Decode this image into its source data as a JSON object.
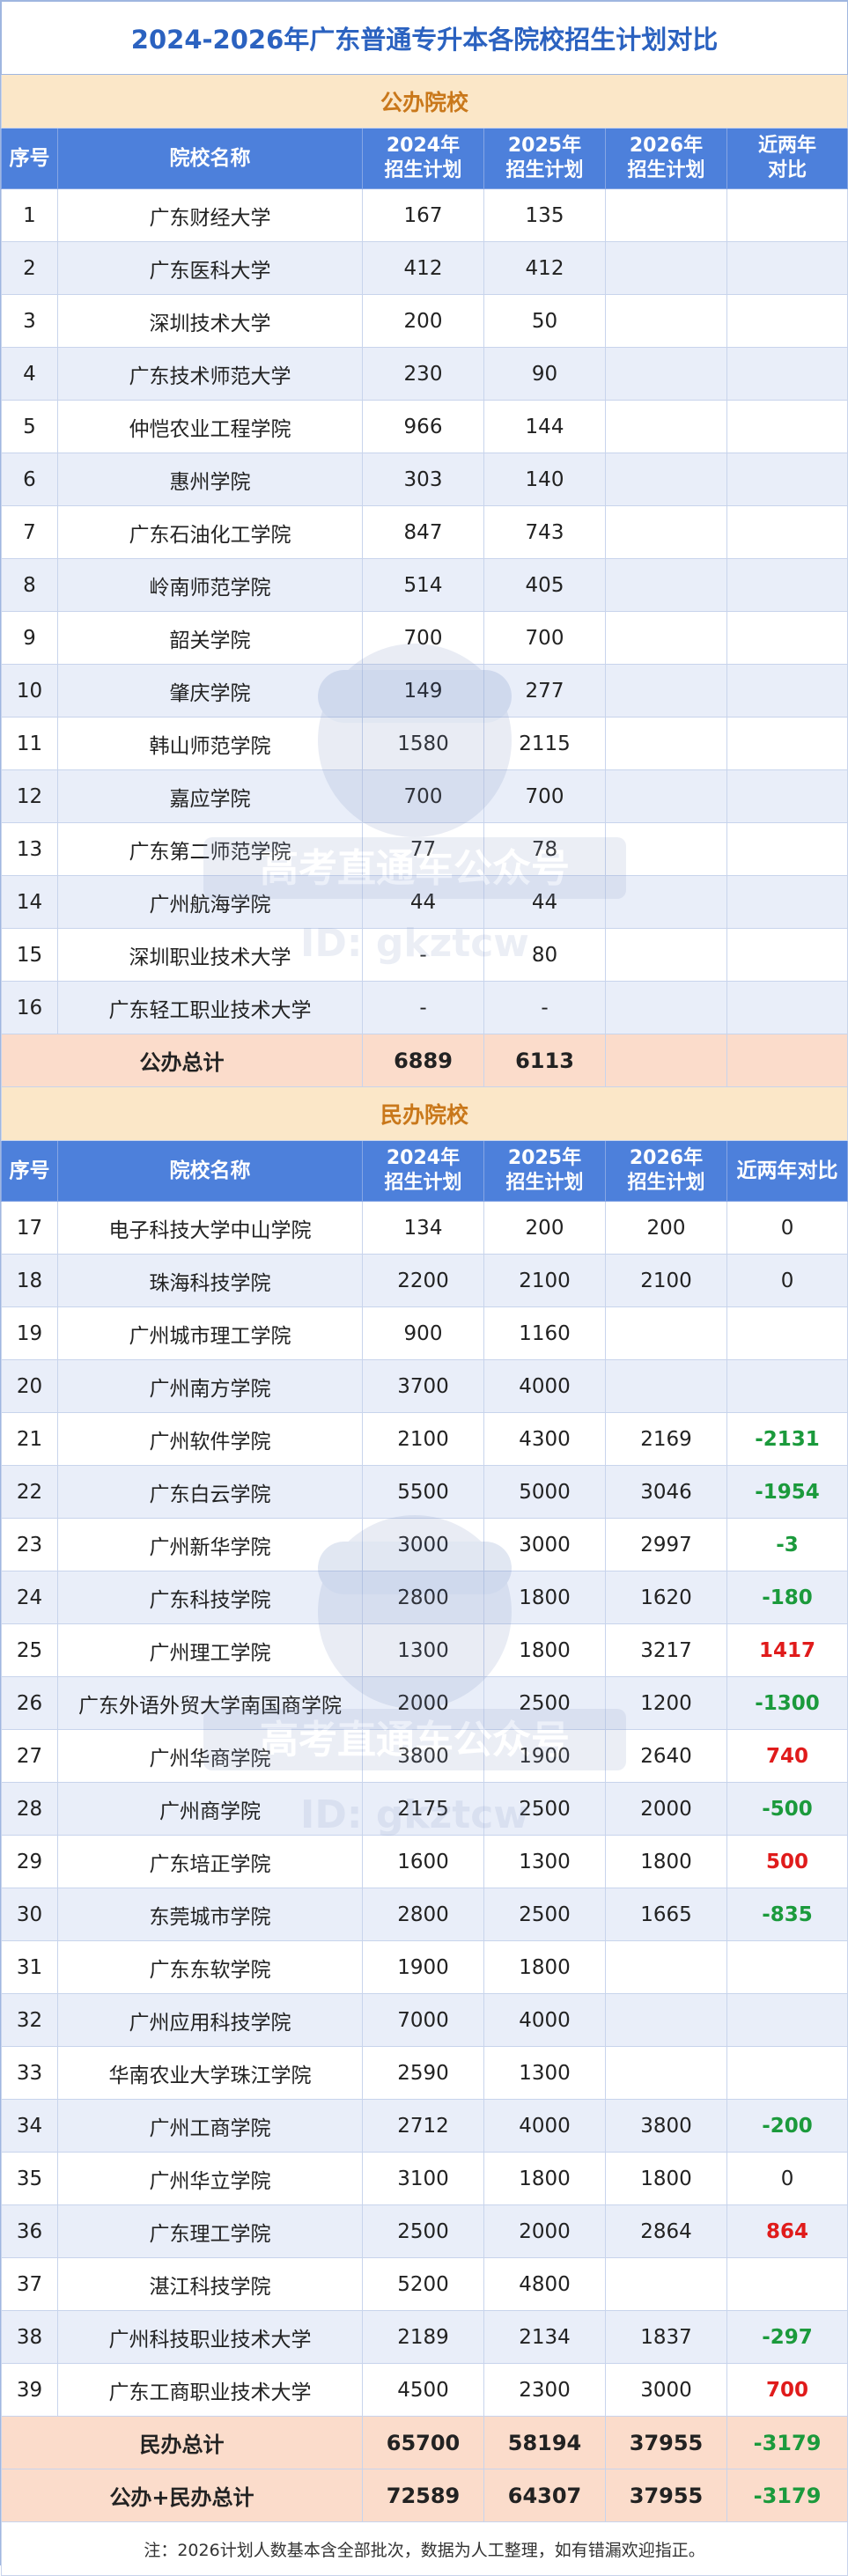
{
  "title": "2024-2026年广东普通专升本各院校招生计划对比",
  "watermark": {
    "line1": "高考直通车公众号",
    "line2": "ID: gkztcw"
  },
  "colors": {
    "header_bg": "#4d80db",
    "section_bg": "#fbe7c8",
    "total_bg": "#fbdccb",
    "stripe": "#e9eef9",
    "negative": "#1b9a3c",
    "positive": "#e01b1b",
    "title": "#2b62c0"
  },
  "public": {
    "section_label": "公办院校",
    "headers": {
      "idx": "序号",
      "name": "院校名称",
      "y2024_l1": "2024年",
      "y2024_l2": "招生计划",
      "y2025_l1": "2025年",
      "y2025_l2": "招生计划",
      "y2026_l1": "2026年",
      "y2026_l2": "招生计划",
      "cmp_l1": "近两年",
      "cmp_l2": "对比"
    },
    "rows": [
      {
        "idx": "1",
        "name": "广东财经大学",
        "y2024": "167",
        "y2025": "135",
        "y2026": "",
        "cmp": ""
      },
      {
        "idx": "2",
        "name": "广东医科大学",
        "y2024": "412",
        "y2025": "412",
        "y2026": "",
        "cmp": ""
      },
      {
        "idx": "3",
        "name": "深圳技术大学",
        "y2024": "200",
        "y2025": "50",
        "y2026": "",
        "cmp": ""
      },
      {
        "idx": "4",
        "name": "广东技术师范大学",
        "y2024": "230",
        "y2025": "90",
        "y2026": "",
        "cmp": ""
      },
      {
        "idx": "5",
        "name": "仲恺农业工程学院",
        "y2024": "966",
        "y2025": "144",
        "y2026": "",
        "cmp": ""
      },
      {
        "idx": "6",
        "name": "惠州学院",
        "y2024": "303",
        "y2025": "140",
        "y2026": "",
        "cmp": ""
      },
      {
        "idx": "7",
        "name": "广东石油化工学院",
        "y2024": "847",
        "y2025": "743",
        "y2026": "",
        "cmp": ""
      },
      {
        "idx": "8",
        "name": "岭南师范学院",
        "y2024": "514",
        "y2025": "405",
        "y2026": "",
        "cmp": ""
      },
      {
        "idx": "9",
        "name": "韶关学院",
        "y2024": "700",
        "y2025": "700",
        "y2026": "",
        "cmp": ""
      },
      {
        "idx": "10",
        "name": "肇庆学院",
        "y2024": "149",
        "y2025": "277",
        "y2026": "",
        "cmp": ""
      },
      {
        "idx": "11",
        "name": "韩山师范学院",
        "y2024": "1580",
        "y2025": "2115",
        "y2026": "",
        "cmp": ""
      },
      {
        "idx": "12",
        "name": "嘉应学院",
        "y2024": "700",
        "y2025": "700",
        "y2026": "",
        "cmp": ""
      },
      {
        "idx": "13",
        "name": "广东第二师范学院",
        "y2024": "77",
        "y2025": "78",
        "y2026": "",
        "cmp": ""
      },
      {
        "idx": "14",
        "name": "广州航海学院",
        "y2024": "44",
        "y2025": "44",
        "y2026": "",
        "cmp": ""
      },
      {
        "idx": "15",
        "name": "深圳职业技术大学",
        "y2024": "-",
        "y2025": "80",
        "y2026": "",
        "cmp": ""
      },
      {
        "idx": "16",
        "name": "广东轻工职业技术大学",
        "y2024": "-",
        "y2025": "-",
        "y2026": "",
        "cmp": ""
      }
    ],
    "total": {
      "label": "公办总计",
      "y2024": "6889",
      "y2025": "6113",
      "y2026": "",
      "cmp": ""
    }
  },
  "private": {
    "section_label": "民办院校",
    "headers": {
      "idx": "序号",
      "name": "院校名称",
      "y2024_l1": "2024年",
      "y2024_l2": "招生计划",
      "y2025_l1": "2025年",
      "y2025_l2": "招生计划",
      "y2026_l1": "2026年",
      "y2026_l2": "招生计划",
      "cmp": "近两年对比"
    },
    "rows": [
      {
        "idx": "17",
        "name": "电子科技大学中山学院",
        "y2024": "134",
        "y2025": "200",
        "y2026": "200",
        "cmp": "0",
        "tone": "plain"
      },
      {
        "idx": "18",
        "name": "珠海科技学院",
        "y2024": "2200",
        "y2025": "2100",
        "y2026": "2100",
        "cmp": "0",
        "tone": "plain"
      },
      {
        "idx": "19",
        "name": "广州城市理工学院",
        "y2024": "900",
        "y2025": "1160",
        "y2026": "",
        "cmp": "",
        "tone": "plain"
      },
      {
        "idx": "20",
        "name": "广州南方学院",
        "y2024": "3700",
        "y2025": "4000",
        "y2026": "",
        "cmp": "",
        "tone": "plain"
      },
      {
        "idx": "21",
        "name": "广州软件学院",
        "y2024": "2100",
        "y2025": "4300",
        "y2026": "2169",
        "cmp": "-2131",
        "tone": "green"
      },
      {
        "idx": "22",
        "name": "广东白云学院",
        "y2024": "5500",
        "y2025": "5000",
        "y2026": "3046",
        "cmp": "-1954",
        "tone": "green"
      },
      {
        "idx": "23",
        "name": "广州新华学院",
        "y2024": "3000",
        "y2025": "3000",
        "y2026": "2997",
        "cmp": "-3",
        "tone": "green"
      },
      {
        "idx": "24",
        "name": "广东科技学院",
        "y2024": "2800",
        "y2025": "1800",
        "y2026": "1620",
        "cmp": "-180",
        "tone": "green"
      },
      {
        "idx": "25",
        "name": "广州理工学院",
        "y2024": "1300",
        "y2025": "1800",
        "y2026": "3217",
        "cmp": "1417",
        "tone": "red"
      },
      {
        "idx": "26",
        "name": "广东外语外贸大学南国商学院",
        "y2024": "2000",
        "y2025": "2500",
        "y2026": "1200",
        "cmp": "-1300",
        "tone": "green"
      },
      {
        "idx": "27",
        "name": "广州华商学院",
        "y2024": "3800",
        "y2025": "1900",
        "y2026": "2640",
        "cmp": "740",
        "tone": "red"
      },
      {
        "idx": "28",
        "name": "广州商学院",
        "y2024": "2175",
        "y2025": "2500",
        "y2026": "2000",
        "cmp": "-500",
        "tone": "green"
      },
      {
        "idx": "29",
        "name": "广东培正学院",
        "y2024": "1600",
        "y2025": "1300",
        "y2026": "1800",
        "cmp": "500",
        "tone": "red"
      },
      {
        "idx": "30",
        "name": "东莞城市学院",
        "y2024": "2800",
        "y2025": "2500",
        "y2026": "1665",
        "cmp": "-835",
        "tone": "green"
      },
      {
        "idx": "31",
        "name": "广东东软学院",
        "y2024": "1900",
        "y2025": "1800",
        "y2026": "",
        "cmp": "",
        "tone": "plain"
      },
      {
        "idx": "32",
        "name": "广州应用科技学院",
        "y2024": "7000",
        "y2025": "4000",
        "y2026": "",
        "cmp": "",
        "tone": "plain"
      },
      {
        "idx": "33",
        "name": "华南农业大学珠江学院",
        "y2024": "2590",
        "y2025": "1300",
        "y2026": "",
        "cmp": "",
        "tone": "plain"
      },
      {
        "idx": "34",
        "name": "广州工商学院",
        "y2024": "2712",
        "y2025": "4000",
        "y2026": "3800",
        "cmp": "-200",
        "tone": "green"
      },
      {
        "idx": "35",
        "name": "广州华立学院",
        "y2024": "3100",
        "y2025": "1800",
        "y2026": "1800",
        "cmp": "0",
        "tone": "plain"
      },
      {
        "idx": "36",
        "name": "广东理工学院",
        "y2024": "2500",
        "y2025": "2000",
        "y2026": "2864",
        "cmp": "864",
        "tone": "red"
      },
      {
        "idx": "37",
        "name": "湛江科技学院",
        "y2024": "5200",
        "y2025": "4800",
        "y2026": "",
        "cmp": "",
        "tone": "plain"
      },
      {
        "idx": "38",
        "name": "广州科技职业技术大学",
        "y2024": "2189",
        "y2025": "2134",
        "y2026": "1837",
        "cmp": "-297",
        "tone": "green"
      },
      {
        "idx": "39",
        "name": "广东工商职业技术大学",
        "y2024": "4500",
        "y2025": "2300",
        "y2026": "3000",
        "cmp": "700",
        "tone": "red"
      }
    ],
    "total": {
      "label": "民办总计",
      "y2024": "65700",
      "y2025": "58194",
      "y2026": "37955",
      "cmp": "-3179"
    }
  },
  "grand_total": {
    "label": "公办+民办总计",
    "y2024": "72589",
    "y2025": "64307",
    "y2026": "37955",
    "cmp": "-3179"
  },
  "note": "注：2026计划人数基本含全部批次，数据为人工整理，如有错漏欢迎指正。"
}
